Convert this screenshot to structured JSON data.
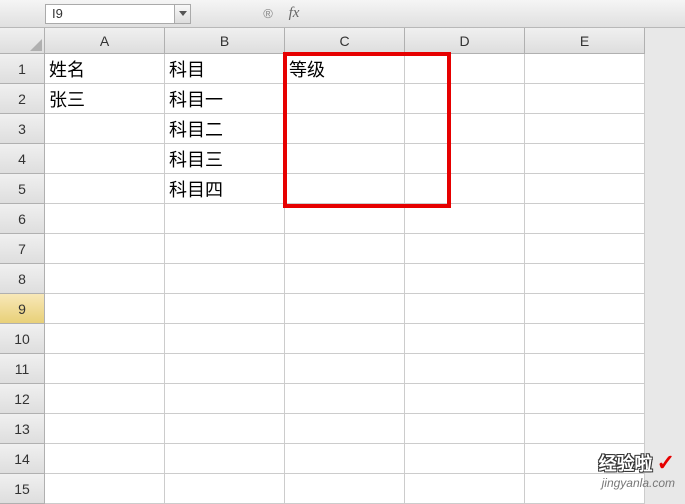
{
  "name_box": {
    "value": "I9"
  },
  "formula_button": {
    "label": "®"
  },
  "fx": {
    "label": "fx"
  },
  "columns": [
    "A",
    "B",
    "C",
    "D",
    "E"
  ],
  "rows": [
    "1",
    "2",
    "3",
    "4",
    "5",
    "6",
    "7",
    "8",
    "9",
    "10",
    "11",
    "12",
    "13",
    "14",
    "15"
  ],
  "active_row": "9",
  "cells": {
    "A1": "姓名",
    "B1": "科目",
    "C1": "等级",
    "A2": "张三",
    "B2": "科目一",
    "B3": "科目二",
    "B4": "科目三",
    "B5": "科目四"
  },
  "watermark": {
    "title": "经验啦",
    "check": "✓",
    "url": "jingyanla.com"
  }
}
